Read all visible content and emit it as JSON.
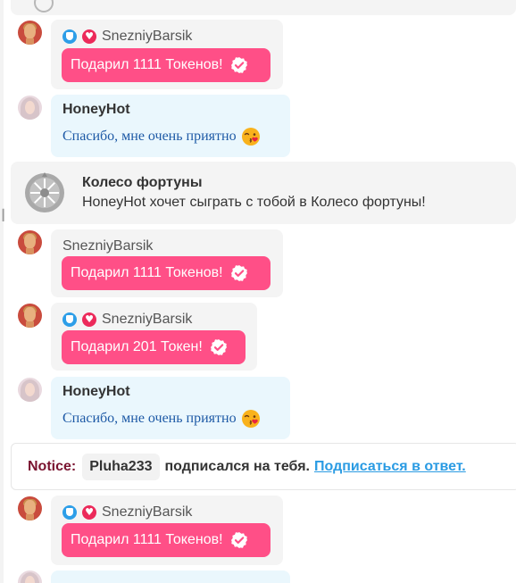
{
  "messages": [
    {
      "user": "SnezniyBarsik",
      "gift": "Подарил 1111 Токенов!"
    },
    {
      "user": "HoneyHot",
      "text": "Спасибо, мне очень приятно"
    },
    {
      "user": "SnezniyBarsik",
      "gift": "Подарил 1111 Токенов!"
    },
    {
      "user": "SnezniyBarsik",
      "gift": "Подарил 201 Токен!"
    },
    {
      "user": "HoneyHot",
      "text": "Спасибо, мне очень приятно"
    },
    {
      "user": "SnezniyBarsik",
      "gift": "Подарил 1111 Токенов!"
    }
  ],
  "fortune": {
    "title": "Колесо фортуны",
    "description": "HoneyHot хочет сыграть с тобой в Колесо фортуны!"
  },
  "notice": {
    "label": "Notice:",
    "user": "Pluha233",
    "text": "подписался на тебя.",
    "link": "Подписаться в ответ."
  },
  "colors": {
    "gift_pink": "#ff4f87",
    "link_blue": "#2a9be3",
    "notice_label": "#7a1430",
    "message_text": "#1e5aa6",
    "moderator_badge": "#2d9ee8",
    "fan_badge": "#ec2a5a"
  },
  "icons": {
    "gift_check": "verified-check-icon",
    "emoji": "kissing-face-emoji",
    "fortune": "fortune-wheel-icon",
    "moderator_badge": "shield-icon",
    "fan_badge": "heart-icon"
  }
}
